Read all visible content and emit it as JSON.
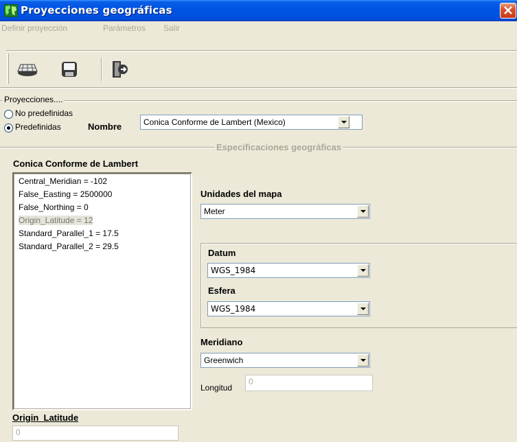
{
  "window": {
    "title": "Proyecciones geográficas",
    "accent_color": "#0054e3",
    "icon": "world-map-icon"
  },
  "menu": {
    "items": [
      "Definir proyección",
      "Parámetros",
      "Salir"
    ]
  },
  "toolbar": {
    "buttons": [
      "grid-projection-icon",
      "save-disk-icon",
      "exit-door-icon"
    ]
  },
  "projections": {
    "group_title": "Proyecciones....",
    "option_undefined": "No predefinidas",
    "option_predefined": "Predefinidas",
    "selected": "Predefinidas",
    "name_label": "Nombre",
    "name_value": "Conica Conforme de Lambert (Mexico)"
  },
  "specs": {
    "group_title": "Especificaciones geográficas",
    "projection_title": "Conica Conforme de Lambert",
    "parameters": [
      "Central_Meridian = -102",
      "False_Easting = 2500000",
      "False_Northing = 0",
      "Origin_Latitude = 12",
      "Standard_Parallel_1 = 17.5",
      "Standard_Parallel_2 = 29.5"
    ],
    "selected_parameter_label": "Origin_Latitude",
    "selected_parameter_value": "0"
  },
  "map_units": {
    "label": "Unidades del mapa",
    "value": "Meter"
  },
  "datum": {
    "label": "Datum",
    "value": "WGS_1984",
    "spheroid_label": "Esfera",
    "spheroid_value": "WGS_1984"
  },
  "meridian": {
    "label": "Meridiano",
    "value": "Greenwich",
    "longitude_label": "Longitud",
    "longitude_value": "0"
  }
}
